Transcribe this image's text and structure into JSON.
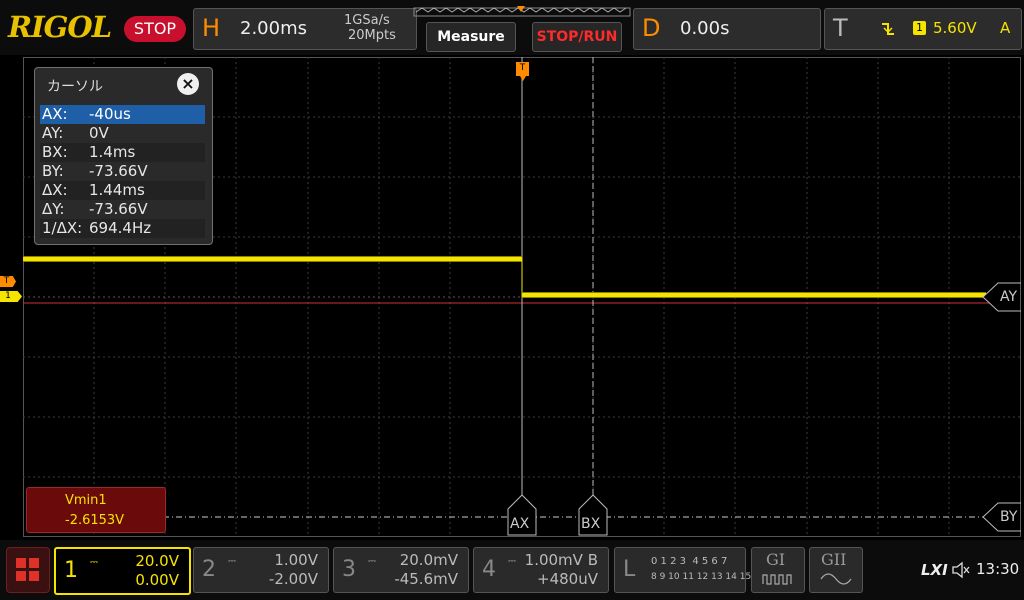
{
  "brand": "RIGOL",
  "run_state": "STOP",
  "horizontal": {
    "letter": "H",
    "timebase": "2.00ms",
    "sample_rate": "1GSa/s",
    "memory_depth": "20Mpts"
  },
  "buttons": {
    "measure": "Measure",
    "stop_run": "STOP/RUN"
  },
  "delay": {
    "letter": "D",
    "value": "0.00s"
  },
  "trigger": {
    "letter": "T",
    "channel": "1",
    "level": "5.60V",
    "mode": "A"
  },
  "cursor_panel": {
    "title": "カーソル",
    "close": "×",
    "rows": [
      {
        "key": "AX:",
        "value": "-40us"
      },
      {
        "key": "AY:",
        "value": "0V"
      },
      {
        "key": "BX:",
        "value": "1.4ms"
      },
      {
        "key": "BY:",
        "value": "-73.66V"
      },
      {
        "key": "ΔX:",
        "value": "1.44ms"
      },
      {
        "key": "ΔY:",
        "value": "-73.66V"
      },
      {
        "key": "1/ΔX:",
        "value": "694.4Hz"
      }
    ]
  },
  "cursor_labels": {
    "ax": "AX",
    "bx": "BX",
    "ay": "AY",
    "by": "BY"
  },
  "left_markers": {
    "trigger": "T",
    "channel": "1"
  },
  "top_marker": "T",
  "measurement": {
    "name": "Vmin1",
    "value": "-2.6153V"
  },
  "channels": [
    {
      "num": "1",
      "scale": "20.0V",
      "offset": "0.00V"
    },
    {
      "num": "2",
      "scale": "1.00V",
      "offset": "-2.00V"
    },
    {
      "num": "3",
      "scale": "20.0mV",
      "offset": "-45.6mV"
    },
    {
      "num": "4",
      "scale": "1.00mV B",
      "offset": "+480uV"
    }
  ],
  "logic": {
    "letter": "L",
    "row1": "0 1 2 3  4 5 6 7",
    "row2": "8 9 10 11 12 13 14 15"
  },
  "gen": {
    "g1": "GI",
    "g2": "GII"
  },
  "status": {
    "lxi": "LXI",
    "time": "13:30"
  },
  "colors": {
    "ch1": "#f5e400",
    "ch2": "#00d5e8",
    "ch3": "#ff3cc8",
    "ch4": "#3a6fff",
    "accent": "#ff8c00",
    "cursor_selected": "#1f5fa8"
  }
}
